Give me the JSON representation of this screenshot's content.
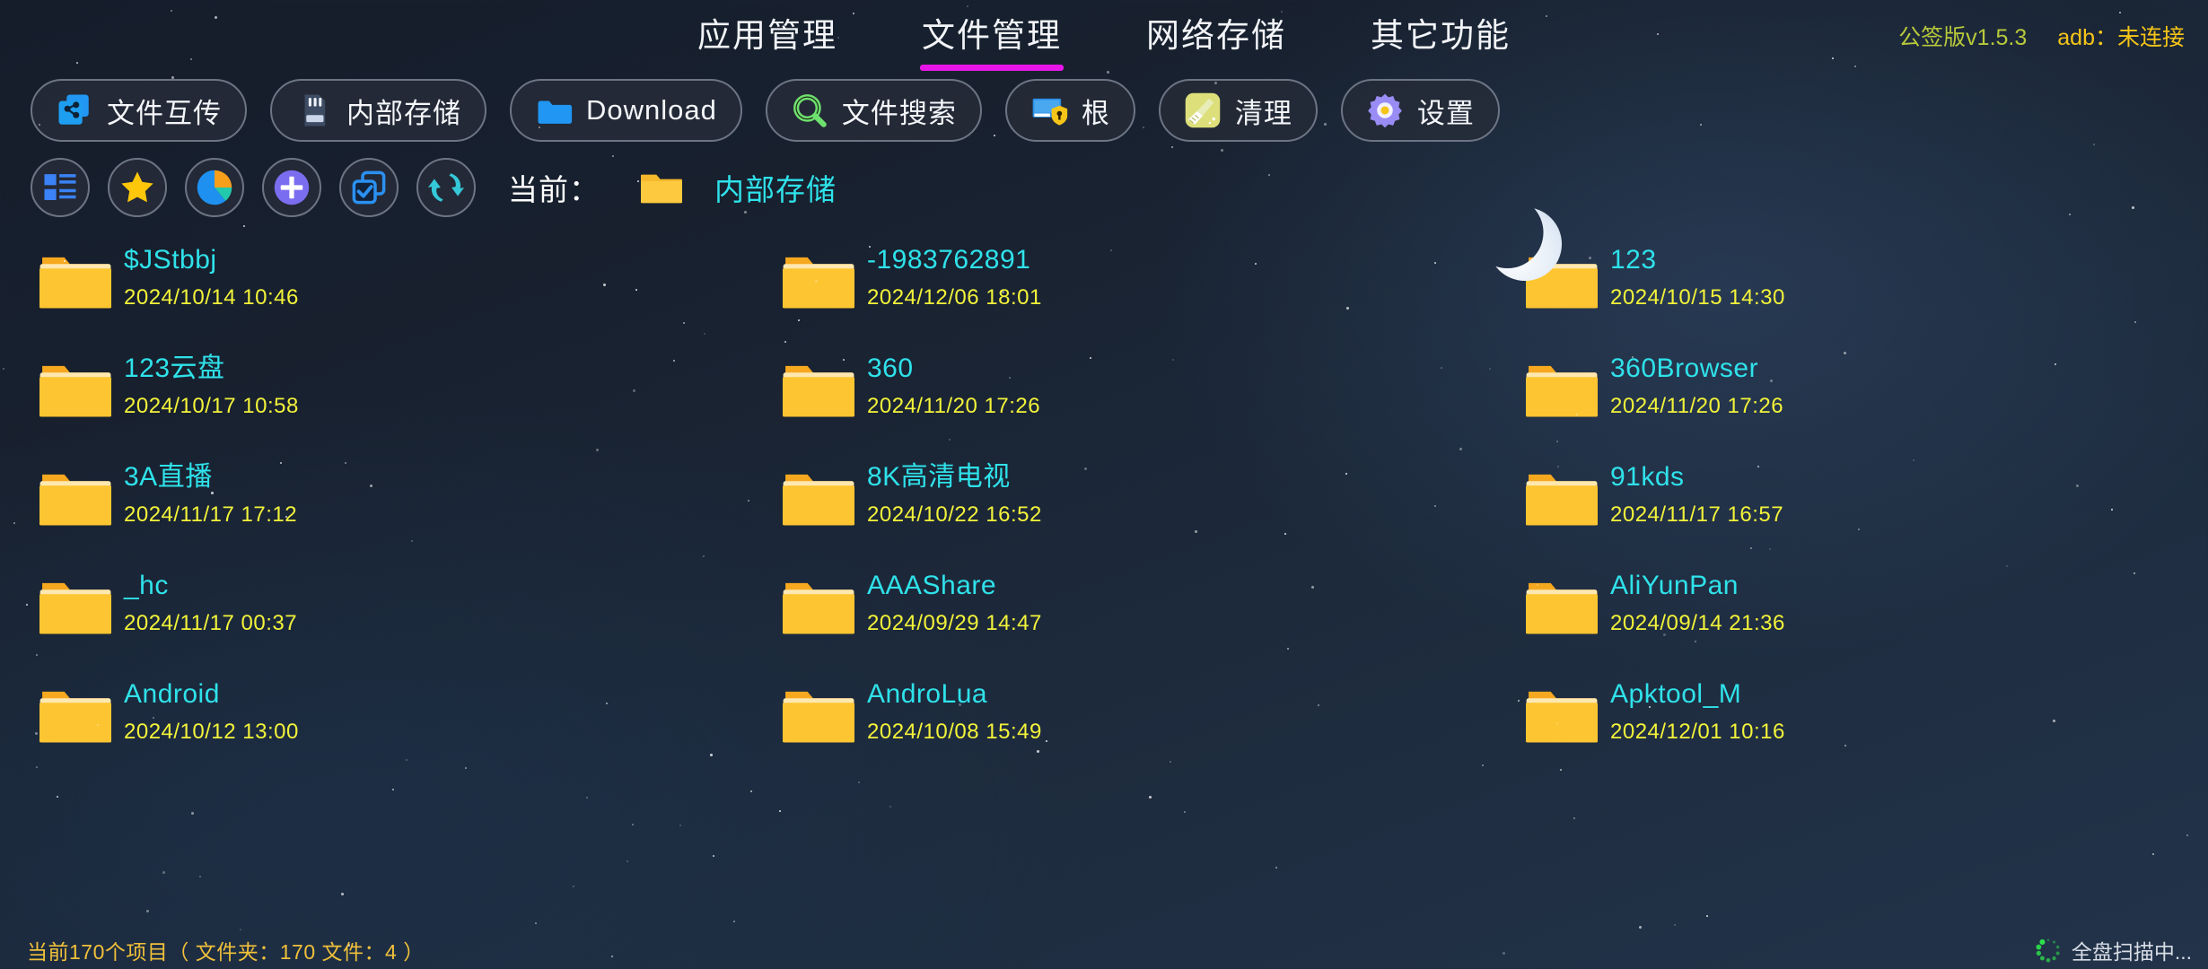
{
  "header": {
    "tabs": [
      {
        "label": "应用管理",
        "active": false
      },
      {
        "label": "文件管理",
        "active": true
      },
      {
        "label": "网络存储",
        "active": false
      },
      {
        "label": "其它功能",
        "active": false
      }
    ],
    "version": "公签版v1.5.3",
    "adb_status": "adb：未连接",
    "accent_underline": "#e815e8",
    "version_color": "#b8c93a",
    "adb_color": "#f5c518"
  },
  "toolbar_primary": [
    {
      "label": "文件互传",
      "icon": "file-transfer-icon"
    },
    {
      "label": "内部存储",
      "icon": "sdcard-icon"
    },
    {
      "label": "Download",
      "icon": "blue-folder-icon"
    },
    {
      "label": "文件搜索",
      "icon": "search-icon"
    },
    {
      "label": "根",
      "icon": "root-shield-icon"
    },
    {
      "label": "清理",
      "icon": "broom-icon"
    },
    {
      "label": "设置",
      "icon": "gear-icon"
    }
  ],
  "toolbar_secondary": {
    "buttons": [
      {
        "icon": "list-view-icon",
        "name": "view-mode-button"
      },
      {
        "icon": "star-icon",
        "name": "favorites-button"
      },
      {
        "icon": "pie-chart-icon",
        "name": "storage-analysis-button"
      },
      {
        "icon": "plus-icon",
        "name": "new-item-button"
      },
      {
        "icon": "multi-select-icon",
        "name": "multi-select-button"
      },
      {
        "icon": "refresh-icon",
        "name": "refresh-button"
      }
    ],
    "current_label": "当前：",
    "current_path": "内部存储",
    "path_color": "#2fe2ea"
  },
  "files": {
    "name_color": "#2fe2ea",
    "date_color": "#f3f33a",
    "items": [
      {
        "name": "$JStbbj",
        "date": "2024/10/14 10:46",
        "type": "folder"
      },
      {
        "name": "-1983762891",
        "date": "2024/12/06 18:01",
        "type": "folder"
      },
      {
        "name": "123",
        "date": "2024/10/15 14:30",
        "type": "folder"
      },
      {
        "name": "123云盘",
        "date": "2024/10/17 10:58",
        "type": "folder"
      },
      {
        "name": "360",
        "date": "2024/11/20 17:26",
        "type": "folder"
      },
      {
        "name": "360Browser",
        "date": "2024/11/20 17:26",
        "type": "folder"
      },
      {
        "name": "3A直播",
        "date": "2024/11/17 17:12",
        "type": "folder"
      },
      {
        "name": "8K高清电视",
        "date": "2024/10/22 16:52",
        "type": "folder"
      },
      {
        "name": "91kds",
        "date": "2024/11/17 16:57",
        "type": "folder"
      },
      {
        "name": "_hc",
        "date": "2024/11/17 00:37",
        "type": "folder"
      },
      {
        "name": "AAAShare",
        "date": "2024/09/29 14:47",
        "type": "folder"
      },
      {
        "name": "AliYunPan",
        "date": "2024/09/14 21:36",
        "type": "folder"
      },
      {
        "name": "Android",
        "date": "2024/10/12 13:00",
        "type": "folder"
      },
      {
        "name": "AndroLua",
        "date": "2024/10/08 15:49",
        "type": "folder"
      },
      {
        "name": "Apktool_M",
        "date": "2024/12/01 10:16",
        "type": "folder"
      }
    ]
  },
  "statusbar": {
    "count_text": "当前170个项目（ 文件夹：170   文件：4 ）",
    "count_color": "#f0c03a",
    "scan_text": "全盘扫描中...",
    "scan_spinner_color": "#2ee84a"
  }
}
